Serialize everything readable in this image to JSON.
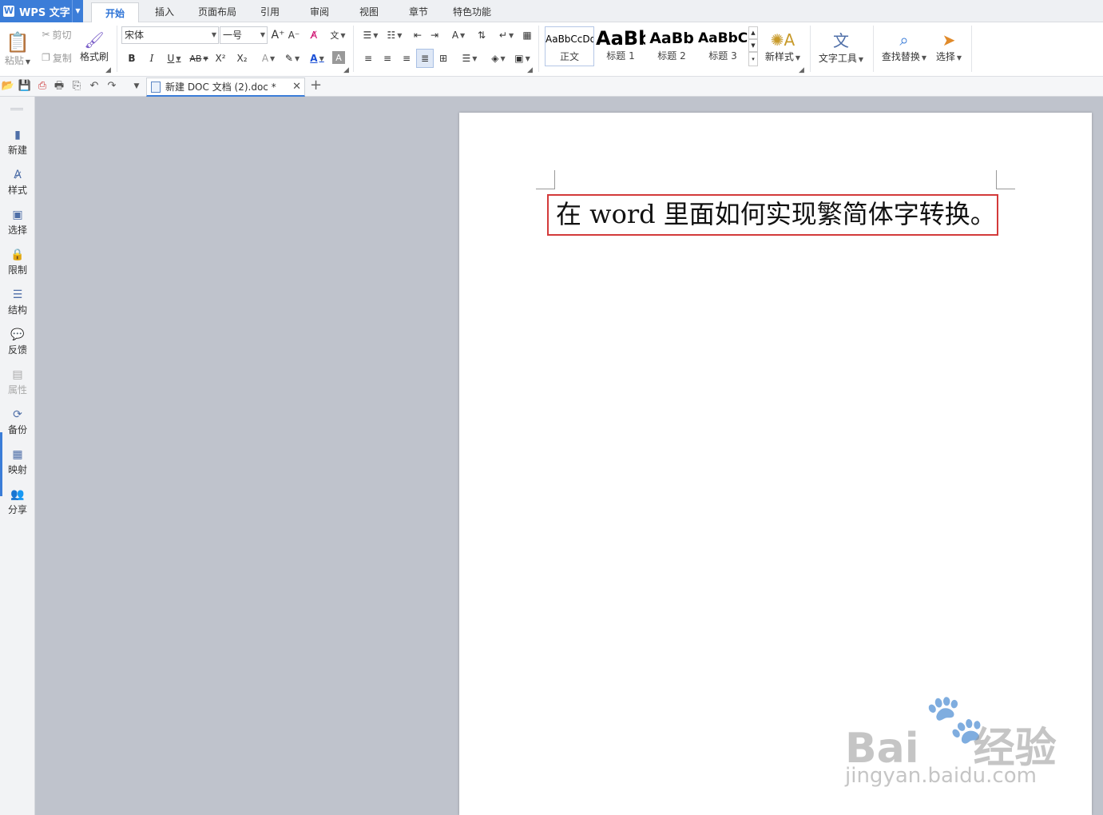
{
  "app": {
    "name": "WPS 文字",
    "logo": "W"
  },
  "menu": {
    "tabs": [
      "开始",
      "插入",
      "页面布局",
      "引用",
      "审阅",
      "视图",
      "章节",
      "特色功能"
    ],
    "active_index": 0
  },
  "ribbon": {
    "paste_label": "粘贴",
    "cut_label": "剪切",
    "copy_label": "复制",
    "format_painter_label": "格式刷",
    "font_name": "宋体",
    "font_size": "一号",
    "styles": [
      {
        "sample": "AaBbCcDd",
        "name": "正文"
      },
      {
        "sample": "AaBb",
        "name": "标题 1"
      },
      {
        "sample": "AaBb",
        "name": "标题 2"
      },
      {
        "sample": "AaBbC",
        "name": "标题 3"
      }
    ],
    "new_style_label": "新样式",
    "text_tools_label": "文字工具",
    "find_replace_label": "查找替换",
    "select_label": "选择"
  },
  "document_tab": {
    "title": "新建 DOC 文档 (2).doc *"
  },
  "sidebar": {
    "items": [
      {
        "label": "新建",
        "icon": "new-doc-icon",
        "enabled": true
      },
      {
        "label": "样式",
        "icon": "style-icon",
        "enabled": true
      },
      {
        "label": "选择",
        "icon": "select-icon",
        "enabled": true
      },
      {
        "label": "限制",
        "icon": "restrict-icon",
        "enabled": true
      },
      {
        "label": "结构",
        "icon": "structure-icon",
        "enabled": true
      },
      {
        "label": "反馈",
        "icon": "feedback-icon",
        "enabled": true
      },
      {
        "label": "属性",
        "icon": "properties-icon",
        "enabled": false
      },
      {
        "label": "备份",
        "icon": "backup-icon",
        "enabled": true
      },
      {
        "label": "映射",
        "icon": "mapping-icon",
        "enabled": true
      },
      {
        "label": "分享",
        "icon": "share-icon",
        "enabled": true
      }
    ]
  },
  "document": {
    "text": "在 word 里面如何实现繁简体字转换。"
  },
  "watermark": {
    "brand": "Bai",
    "brand_suffix": "经验",
    "url": "jingyan.baidu.com"
  },
  "colors": {
    "accent": "#3b7dd8",
    "highlight_border": "#d33a3a",
    "workspace": "#bfc3cc"
  }
}
